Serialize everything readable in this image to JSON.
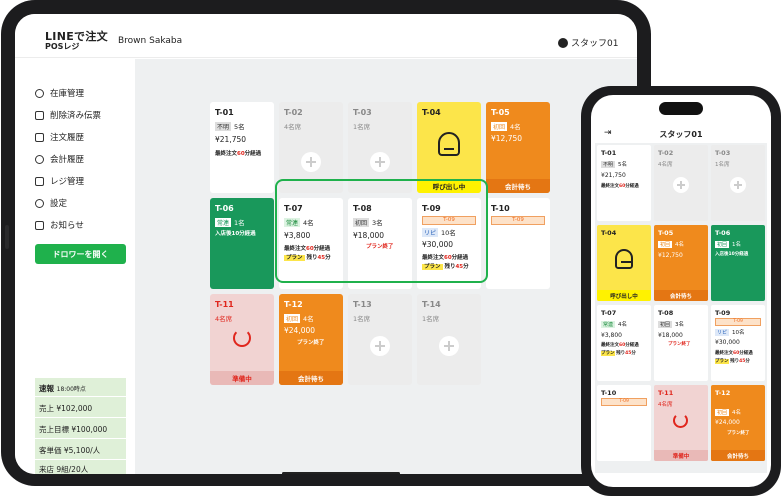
{
  "app": {
    "logo_line1": "LINEで注文",
    "logo_line2": "POSレジ",
    "shop": "Brown Sakaba",
    "staff": "スタッフ01"
  },
  "nav": [
    "在庫管理",
    "削除済み伝票",
    "注文履歴",
    "会計履歴",
    "レジ管理",
    "設定",
    "お知らせ"
  ],
  "drawer": "ドロワーを開く",
  "stats": {
    "title": "速報",
    "time": "18:00時点",
    "sales": "売上 ¥102,000",
    "target": "売上目標 ¥100,000",
    "unit": "客単価 ¥5,100/人",
    "visitors": "来店 9組/20人"
  },
  "tables": {
    "t01": {
      "name": "T-01",
      "badge": "不明",
      "guests": "5名",
      "amount": "¥21,750",
      "note_a": "最終注文",
      "note_b": "60",
      "note_c": "分経過"
    },
    "t02": {
      "name": "T-02",
      "guests": "4名席"
    },
    "t03": {
      "name": "T-03",
      "guests": "1名席"
    },
    "t04": {
      "name": "T-04",
      "footer": "呼び出し中"
    },
    "t05": {
      "name": "T-05",
      "badge": "初回",
      "guests": "4名",
      "amount": "¥12,750",
      "footer": "会計待ち"
    },
    "t06": {
      "name": "T-06",
      "badge": "常連",
      "guests": "1名",
      "note": "入店後10分経過"
    },
    "t07": {
      "name": "T-07",
      "badge": "常連",
      "guests": "4名",
      "amount": "¥3,800",
      "note_a": "最終注文",
      "note_b": "60",
      "note_c": "分経過",
      "plan": "プラン",
      "plan_rest": "残り",
      "plan_min": "45",
      "plan_unit": "分"
    },
    "t08": {
      "name": "T-08",
      "badge": "初回",
      "guests": "3名",
      "amount": "¥18,000",
      "status": "プラン終了"
    },
    "t09": {
      "name": "T-09",
      "tag": "T-09",
      "badge": "リピ",
      "guests": "10名",
      "amount": "¥30,000",
      "note_a": "最終注文",
      "note_b": "60",
      "note_c": "分経過",
      "plan": "プラン",
      "plan_rest": "残り",
      "plan_min": "45",
      "plan_unit": "分"
    },
    "t10": {
      "name": "T-10",
      "tag": "T-09"
    },
    "t11": {
      "name": "T-11",
      "guests": "4名席",
      "footer": "準備中"
    },
    "t12": {
      "name": "T-12",
      "badge": "初回",
      "guests": "4名",
      "amount": "¥24,000",
      "status": "プラン終了",
      "footer": "会計待ち"
    },
    "t13": {
      "name": "T-13",
      "guests": "1名席"
    },
    "t14": {
      "name": "T-14",
      "guests": "1名席"
    }
  },
  "phone": {
    "title": "スタッフ01",
    "t01": {
      "name": "T-01",
      "badge": "不明",
      "guests": "5名",
      "amount": "¥21,750",
      "note_a": "最終注文",
      "note_b": "60",
      "note_c": "分経過"
    },
    "t02": {
      "name": "T-02",
      "guests": "4名席"
    },
    "t03": {
      "name": "T-03",
      "guests": "1名席"
    },
    "t04": {
      "name": "T-04",
      "footer": "呼び出し中"
    },
    "t05": {
      "name": "T-05",
      "badge": "初回",
      "guests": "4名",
      "amount": "¥12,750",
      "footer": "会計待ち"
    },
    "t06": {
      "name": "T-06",
      "badge": "初回",
      "guests": "1名",
      "note": "入店後10分経過"
    },
    "t07": {
      "name": "T-07",
      "badge": "常連",
      "guests": "4名",
      "amount": "¥3,800",
      "note_a": "最終注文",
      "note_b": "60",
      "note_c": "分経過",
      "plan": "プラン",
      "plan_rest": "残り",
      "plan_min": "45",
      "plan_unit": "分"
    },
    "t08": {
      "name": "T-08",
      "badge": "初回",
      "guests": "3名",
      "amount": "¥18,000",
      "status": "プラン終了"
    },
    "t09": {
      "name": "T-09",
      "tag": "T-09",
      "badge": "リピ",
      "guests": "10名",
      "amount": "¥30,000",
      "note_a": "最終注文",
      "note_b": "60",
      "note_c": "分経過",
      "plan": "プラン",
      "plan_rest": "残り",
      "plan_min": "45",
      "plan_unit": "分"
    },
    "t10": {
      "name": "T-10",
      "tag": "T-09"
    },
    "t11": {
      "name": "T-11",
      "guests": "4名席",
      "footer": "準備中"
    },
    "t12": {
      "name": "T-12",
      "badge": "初回",
      "guests": "4名",
      "amount": "¥24,000",
      "status": "プラン終了",
      "footer": "会計待ち"
    }
  }
}
